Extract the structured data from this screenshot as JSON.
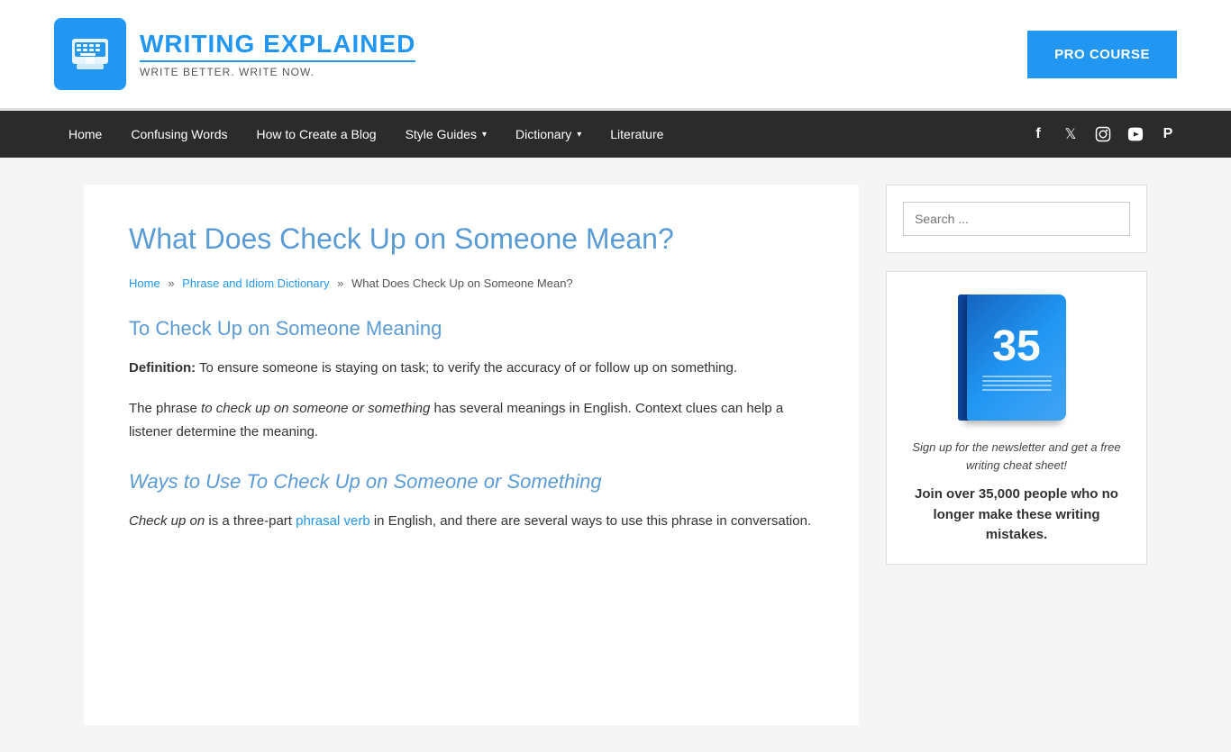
{
  "site": {
    "title": "WRITING EXPLAINED",
    "tagline": "WRITE BETTER. WRITE NOW.",
    "pro_course_label": "PRO COURSE"
  },
  "nav": {
    "items": [
      {
        "label": "Home",
        "has_dropdown": false
      },
      {
        "label": "Confusing Words",
        "has_dropdown": false
      },
      {
        "label": "How to Create a Blog",
        "has_dropdown": false
      },
      {
        "label": "Style Guides",
        "has_dropdown": true
      },
      {
        "label": "Dictionary",
        "has_dropdown": true
      },
      {
        "label": "Literature",
        "has_dropdown": false
      }
    ],
    "social": [
      {
        "name": "facebook-icon",
        "glyph": "f"
      },
      {
        "name": "twitter-icon",
        "glyph": "t"
      },
      {
        "name": "instagram-icon",
        "glyph": "in"
      },
      {
        "name": "youtube-icon",
        "glyph": "▶"
      },
      {
        "name": "pinterest-icon",
        "glyph": "P"
      }
    ]
  },
  "article": {
    "title": "What Does Check Up on Someone Mean?",
    "breadcrumb": {
      "home": "Home",
      "section": "Phrase and Idiom Dictionary",
      "current": "What Does Check Up on Someone Mean?"
    },
    "section1_heading": "To Check Up on Someone Meaning",
    "definition_label": "Definition:",
    "definition_text": " To ensure someone is staying on task; to verify the accuracy of or follow up on something.",
    "phrase_text": "The phrase ",
    "phrase_italic": "to check up on someone or something",
    "phrase_rest": " has several meanings in English. Context clues can help a listener determine the meaning.",
    "section2_heading": "Ways to Use To Check Up on Someone or Something",
    "ways_prefix": "",
    "ways_italic": "Check up on",
    "ways_rest": " is a three-part ",
    "ways_link": "phrasal verb",
    "ways_end": " in English, and there are several ways to use this phrase in conversation."
  },
  "sidebar": {
    "search_placeholder": "Search ...",
    "book_number": "35",
    "signup_text": "Sign up for the newsletter and get a free writing cheat sheet!",
    "join_text": "Join over 35,000 people who no longer make these writing mistakes."
  }
}
